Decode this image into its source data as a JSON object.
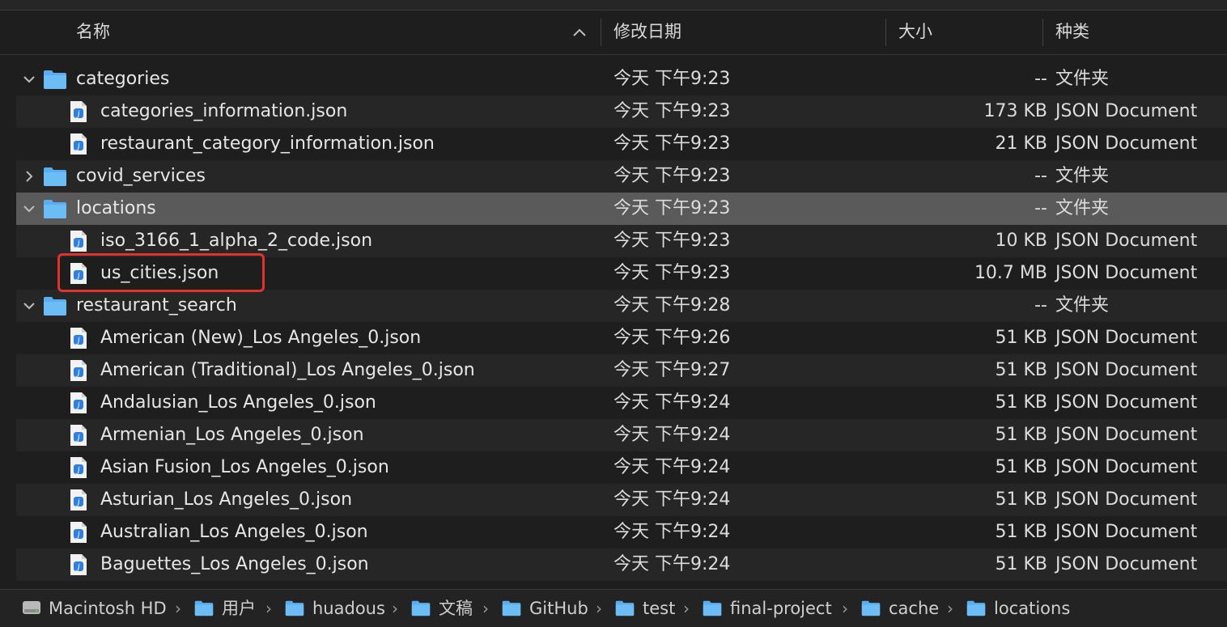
{
  "header": {
    "name": "名称",
    "modified": "修改日期",
    "size": "大小",
    "kind": "种类"
  },
  "rows": [
    {
      "type": "folder",
      "expanded": true,
      "indent": 0,
      "name": "categories",
      "date": "今天 下午9:23",
      "size": "--",
      "kind": "文件夹"
    },
    {
      "type": "file",
      "indent": 1,
      "name": "categories_information.json",
      "date": "今天 下午9:23",
      "size": "173 KB",
      "kind": "JSON Document"
    },
    {
      "type": "file",
      "indent": 1,
      "name": "restaurant_category_information.json",
      "date": "今天 下午9:23",
      "size": "21 KB",
      "kind": "JSON Document"
    },
    {
      "type": "folder",
      "expanded": false,
      "indent": 0,
      "name": "covid_services",
      "date": "今天 下午9:23",
      "size": "--",
      "kind": "文件夹"
    },
    {
      "type": "folder",
      "expanded": true,
      "indent": 0,
      "name": "locations",
      "date": "今天 下午9:23",
      "size": "--",
      "kind": "文件夹",
      "selected": true
    },
    {
      "type": "file",
      "indent": 1,
      "name": "iso_3166_1_alpha_2_code.json",
      "date": "今天 下午9:23",
      "size": "10 KB",
      "kind": "JSON Document"
    },
    {
      "type": "file",
      "indent": 1,
      "name": "us_cities.json",
      "date": "今天 下午9:23",
      "size": "10.7 MB",
      "kind": "JSON Document",
      "highlighted": true
    },
    {
      "type": "folder",
      "expanded": true,
      "indent": 0,
      "name": "restaurant_search",
      "date": "今天 下午9:28",
      "size": "--",
      "kind": "文件夹"
    },
    {
      "type": "file",
      "indent": 1,
      "name": "American (New)_Los Angeles_0.json",
      "date": "今天 下午9:26",
      "size": "51 KB",
      "kind": "JSON Document"
    },
    {
      "type": "file",
      "indent": 1,
      "name": "American (Traditional)_Los Angeles_0.json",
      "date": "今天 下午9:27",
      "size": "51 KB",
      "kind": "JSON Document"
    },
    {
      "type": "file",
      "indent": 1,
      "name": "Andalusian_Los Angeles_0.json",
      "date": "今天 下午9:24",
      "size": "51 KB",
      "kind": "JSON Document"
    },
    {
      "type": "file",
      "indent": 1,
      "name": "Armenian_Los Angeles_0.json",
      "date": "今天 下午9:24",
      "size": "51 KB",
      "kind": "JSON Document"
    },
    {
      "type": "file",
      "indent": 1,
      "name": "Asian Fusion_Los Angeles_0.json",
      "date": "今天 下午9:24",
      "size": "51 KB",
      "kind": "JSON Document"
    },
    {
      "type": "file",
      "indent": 1,
      "name": "Asturian_Los Angeles_0.json",
      "date": "今天 下午9:24",
      "size": "51 KB",
      "kind": "JSON Document"
    },
    {
      "type": "file",
      "indent": 1,
      "name": "Australian_Los Angeles_0.json",
      "date": "今天 下午9:24",
      "size": "51 KB",
      "kind": "JSON Document"
    },
    {
      "type": "file",
      "indent": 1,
      "name": "Baguettes_Los Angeles_0.json",
      "date": "今天 下午9:24",
      "size": "51 KB",
      "kind": "JSON Document"
    }
  ],
  "pathbar": [
    {
      "label": "Macintosh HD",
      "icon": "disk-icon"
    },
    {
      "label": "用户",
      "icon": "users-folder-icon"
    },
    {
      "label": "huadous",
      "icon": "home-folder-icon"
    },
    {
      "label": "文稿",
      "icon": "documents-folder-icon"
    },
    {
      "label": "GitHub",
      "icon": "folder-icon"
    },
    {
      "label": "test",
      "icon": "folder-icon"
    },
    {
      "label": "final-project",
      "icon": "folder-icon"
    },
    {
      "label": "cache",
      "icon": "folder-icon"
    },
    {
      "label": "locations",
      "icon": "folder-icon"
    }
  ],
  "colors": {
    "folder": "#5aaef0",
    "selection": "#5a5a5a",
    "highlight": "#e0332f"
  }
}
